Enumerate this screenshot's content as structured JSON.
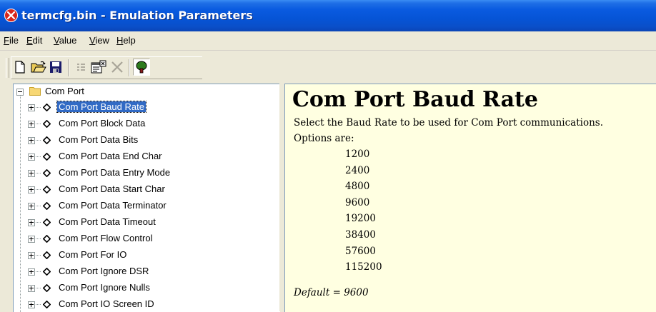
{
  "window": {
    "title": "termcfg.bin - Emulation Parameters"
  },
  "menu": [
    {
      "accel": "F",
      "rest": "ile"
    },
    {
      "accel": "E",
      "rest": "dit"
    },
    {
      "accel": "V",
      "rest": "alue"
    },
    {
      "accel": "V",
      "rest": "iew"
    },
    {
      "accel": "H",
      "rest": "elp"
    }
  ],
  "toolbar": {
    "buttons": [
      "new-file-icon",
      "open-folder-icon",
      "save-disk-icon",
      "list-icon",
      "properties-icon",
      "delete-x-icon",
      "tree-view-icon"
    ],
    "tree_view_pressed": true
  },
  "tree": {
    "root": "Com Port",
    "items": [
      "Com Port Baud Rate",
      "Com Port Block Data",
      "Com Port Data Bits",
      "Com Port Data End Char",
      "Com Port Data Entry Mode",
      "Com Port Data Start Char",
      "Com Port Data Terminator",
      "Com Port Data Timeout",
      "Com Port Flow Control",
      "Com Port For IO",
      "Com Port Ignore DSR",
      "Com Port Ignore Nulls",
      "Com Port IO Screen ID"
    ],
    "selected_index": 0
  },
  "help": {
    "title": "Com Port Baud Rate",
    "description": "Select the Baud Rate to be used for Com Port communications.",
    "options_label": "Options are:",
    "options": [
      "1200",
      "2400",
      "4800",
      "9600",
      "19200",
      "38400",
      "57600",
      "115200"
    ],
    "default": "Default = 9600"
  },
  "colors": {
    "titlebar": "#0a5be0",
    "selection": "#316ac5",
    "help_bg": "#ffffe1",
    "folder": "#f7d774"
  }
}
